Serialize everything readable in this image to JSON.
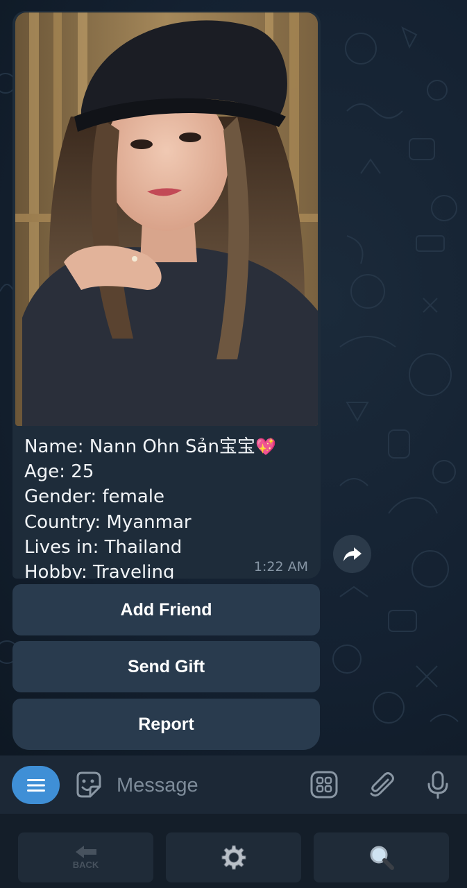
{
  "message": {
    "name_label": "Name: Nann Ohn Sản宝宝",
    "name_emoji": "💖",
    "age": "Age: 25",
    "gender": "Gender: female",
    "country": "Country: Myanmar",
    "lives_in": "Lives in: Thailand",
    "hobby": "Hobby: Traveling",
    "time": "1:22 AM"
  },
  "inline_buttons": {
    "add_friend": "Add Friend",
    "send_gift": "Send Gift",
    "report": "Report"
  },
  "input": {
    "placeholder": "Message"
  },
  "reply_keyboard": {
    "back_label": "BACK"
  },
  "colors": {
    "accent": "#3f8fd6",
    "bubble": "#1e2c3a",
    "button": "#293b4e"
  }
}
